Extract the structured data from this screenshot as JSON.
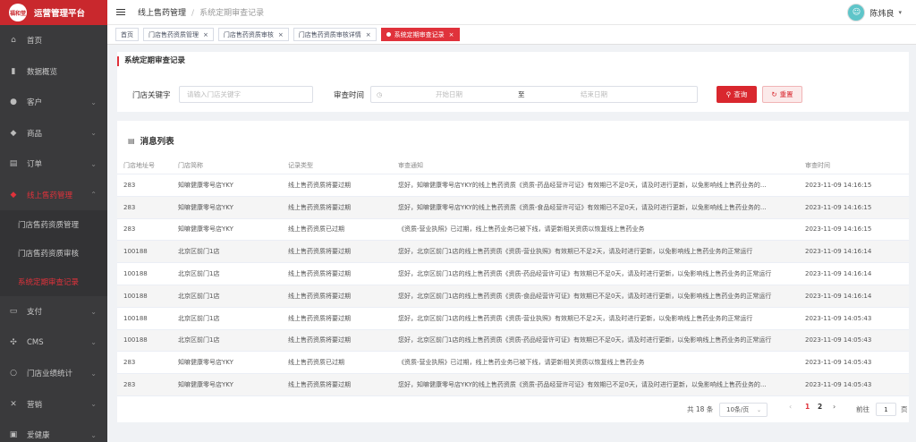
{
  "sidebar": {
    "brand_logo": "福和堂",
    "brand_title": "运营管理平台",
    "items": [
      {
        "label": "首页",
        "icon": "home-icon",
        "glyph": "⌂"
      },
      {
        "label": "数据概览",
        "icon": "chart-icon",
        "glyph": "▮"
      },
      {
        "label": "客户",
        "icon": "user-icon",
        "glyph": "●"
      },
      {
        "label": "商品",
        "icon": "diamond-icon",
        "glyph": "◆"
      },
      {
        "label": "订单",
        "icon": "order-icon",
        "glyph": "▤"
      },
      {
        "label": "线上售药管理",
        "icon": "medicine-icon",
        "glyph": "◆"
      },
      {
        "label": "支付",
        "icon": "wallet-icon",
        "glyph": "▭"
      },
      {
        "label": "CMS",
        "icon": "cms-icon",
        "glyph": "✣"
      },
      {
        "label": "门店业绩统计",
        "icon": "person-icon",
        "glyph": "○"
      },
      {
        "label": "营销",
        "icon": "marketing-icon",
        "glyph": "✕"
      },
      {
        "label": "爱健康",
        "icon": "health-icon",
        "glyph": "▣"
      }
    ],
    "sub_items": [
      {
        "label": "门店售药资质管理"
      },
      {
        "label": "门店售药资质审核"
      },
      {
        "label": "系统定期审查记录"
      }
    ]
  },
  "header": {
    "breadcrumb_1": "线上售药管理",
    "breadcrumb_sep": "/",
    "breadcrumb_2": "系统定期审查记录",
    "user_name": "陈炜良"
  },
  "tabs": [
    {
      "label": "首页"
    },
    {
      "label": "门店售药资质管理"
    },
    {
      "label": "门店售药资质审核"
    },
    {
      "label": "门店售药资质审核详情"
    },
    {
      "label": "系统定期审查记录"
    }
  ],
  "search": {
    "page_title": "系统定期审查记录",
    "keyword_label": "门店关键字",
    "keyword_placeholder": "请输入门店关键字",
    "time_label": "审查时间",
    "start_placeholder": "开始日期",
    "range_sep": "至",
    "end_placeholder": "结束日期",
    "query_label": "查询",
    "reset_label": "重置"
  },
  "table": {
    "title": "消息列表",
    "columns": [
      "门店地址号",
      "门店简称",
      "记录类型",
      "审查通知",
      "审查时间"
    ],
    "rows": [
      [
        "283",
        "知嘛健康零号店YKY",
        "线上售药资质将要过期",
        "您好，知嘛健康零号店YKY的线上售药资质《资质-药品经营许可证》有效期已不足0天，请及时进行更新，以免影响线上售药业务的...",
        "2023-11-09 14:16:15"
      ],
      [
        "283",
        "知嘛健康零号店YKY",
        "线上售药资质将要过期",
        "您好，知嘛健康零号店YKY的线上售药资质《资质-食品经营许可证》有效期已不足0天，请及时进行更新，以免影响线上售药业务的...",
        "2023-11-09 14:16:15"
      ],
      [
        "283",
        "知嘛健康零号店YKY",
        "线上售药资质已过期",
        "《资质-营业执照》已过期，线上售药业务已被下线，请更新相关资质以恢复线上售药业务",
        "2023-11-09 14:16:15"
      ],
      [
        "100188",
        "北京区前门1店",
        "线上售药资质将要过期",
        "您好，北京区前门1店的线上售药资质《资质-营业执照》有效期已不足2天，请及时进行更新，以免影响线上售药业务的正常运行",
        "2023-11-09 14:16:14"
      ],
      [
        "100188",
        "北京区前门1店",
        "线上售药资质将要过期",
        "您好，北京区前门1店的线上售药资质《资质-药品经营许可证》有效期已不足0天，请及时进行更新，以免影响线上售药业务的正常运行",
        "2023-11-09 14:16:14"
      ],
      [
        "100188",
        "北京区前门1店",
        "线上售药资质将要过期",
        "您好，北京区前门1店的线上售药资质《资质-食品经营许可证》有效期已不足0天，请及时进行更新，以免影响线上售药业务的正常运行",
        "2023-11-09 14:16:14"
      ],
      [
        "100188",
        "北京区前门1店",
        "线上售药资质将要过期",
        "您好，北京区前门1店的线上售药资质《资质-营业执照》有效期已不足2天，请及时进行更新，以免影响线上售药业务的正常运行",
        "2023-11-09 14:05:43"
      ],
      [
        "100188",
        "北京区前门1店",
        "线上售药资质将要过期",
        "您好，北京区前门1店的线上售药资质《资质-药品经营许可证》有效期已不足0天，请及时进行更新，以免影响线上售药业务的正常运行",
        "2023-11-09 14:05:43"
      ],
      [
        "283",
        "知嘛健康零号店YKY",
        "线上售药资质已过期",
        "《资质-营业执照》已过期，线上售药业务已被下线，请更新相关资质以恢复线上售药业务",
        "2023-11-09 14:05:43"
      ],
      [
        "283",
        "知嘛健康零号店YKY",
        "线上售药资质将要过期",
        "您好，知嘛健康零号店YKY的线上售药资质《资质-药品经营许可证》有效期已不足0天，请及时进行更新，以免影响线上售药业务的...",
        "2023-11-09 14:05:43"
      ]
    ]
  },
  "pagination": {
    "total_text": "共 18 条",
    "page_size": "10条/页",
    "prev": "‹",
    "next": "›",
    "pages": [
      "1",
      "2"
    ],
    "goto_label": "前往",
    "goto_value": "1",
    "page_unit": "页"
  },
  "colors": {
    "brand": "#c9282d",
    "accent": "#e0323b",
    "sidebar_bg": "#3a3a3c"
  }
}
